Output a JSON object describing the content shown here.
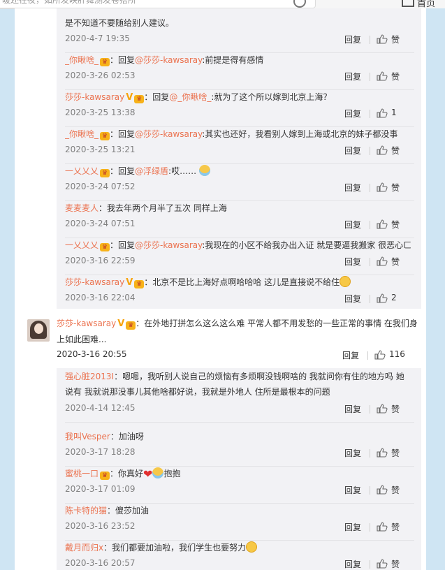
{
  "topbar": {
    "search_placeholder": "暖还在夜，如所发映肝舞测发卷搭所",
    "home_label": "首页"
  },
  "ops": {
    "reply_label": "回复",
    "like_label": "赞"
  },
  "thread1": {
    "items": [
      {
        "text": "是不知道不要随给别人建议。",
        "time": "2020-4-7 19:35",
        "likes": "赞"
      },
      {
        "nick": "_你瞅啥_",
        "reply_to": "@莎莎-kawsaray",
        "text": ":前提是得有感情",
        "time": "2020-3-26 02:53",
        "likes": "赞"
      },
      {
        "nick": "莎莎-kawsaray",
        "verified": "V",
        "reply_to": "@_你瞅啥_",
        "text": ":就为了这个所以嫁到北京上海？",
        "time": "2020-3-25 13:38",
        "likes": "1"
      },
      {
        "nick": "_你瞅啥_",
        "reply_to": "@莎莎-kawsaray",
        "text": ":其实也还好，我看别人嫁到上海或北京的妹子都没事",
        "time": "2020-3-25 13:21",
        "likes": "赞"
      },
      {
        "nick": "一乂乂乂",
        "reply_to": "@浮绿盾",
        "text": ":哎……",
        "time": "2020-3-24 07:52",
        "likes": "赞"
      },
      {
        "nick": "麦麦麦人",
        "text": "：我去年两个月半了五次 同样上海",
        "time": "2020-3-24 07:51",
        "likes": "赞"
      },
      {
        "nick": "一乂乂乂",
        "reply_to": "@莎莎-kawsaray",
        "text": ":我现在的小区不给我办出入证  就是要逼我搬家 很恶心ㄈ",
        "time": "2020-3-16 22:59",
        "likes": "赞"
      },
      {
        "nick": "莎莎-kawsaray",
        "verified": "V",
        "text": "：北京不是比上海好点啊哈哈哈 这儿是直接说不给住",
        "time": "2020-3-16 22:04",
        "likes": "2"
      }
    ]
  },
  "main_comment": {
    "nick": "莎莎-kawsaray",
    "verified": "V",
    "text": "：在外地打拼怎么这么这么难 平常人都不用发愁的一些正常的事情 在我们身上如此困难...",
    "time": "2020-3-16 20:55",
    "likes": "116"
  },
  "thread2": {
    "items": [
      {
        "nick": "强心脏2013I",
        "text": "：嗯嗯，我听别人说自己的烦恼有多烦啊没钱啊啥的 我就问你有住的地方吗 她说有 我就说那没事儿其他啥都好说，我就是外地人 住所是最根本的问题",
        "time": "2020-4-14 12:45",
        "likes": "赞"
      },
      {
        "nick": "我叫Vesper",
        "text": "：加油呀",
        "time": "2020-3-17 18:28",
        "likes": "赞"
      },
      {
        "nick": "蜜桃一口",
        "text": "：你真好",
        "text2": "抱抱",
        "time": "2020-3-17 01:09",
        "likes": "赞"
      },
      {
        "nick": "陈卡特的猫",
        "text": "：傻莎加油",
        "time": "2020-3-16 23:52",
        "likes": "赞"
      },
      {
        "nick": "戴月而归x",
        "text": "：我们都要加油啦，我们学生也要努力",
        "time": "2020-3-16 20:57",
        "likes": "赞"
      }
    ]
  },
  "colors": {
    "nick": "#eb7350",
    "time": "#808080",
    "reply_bg": "#f2f2f5",
    "page_bg": "#cfe5f3"
  }
}
